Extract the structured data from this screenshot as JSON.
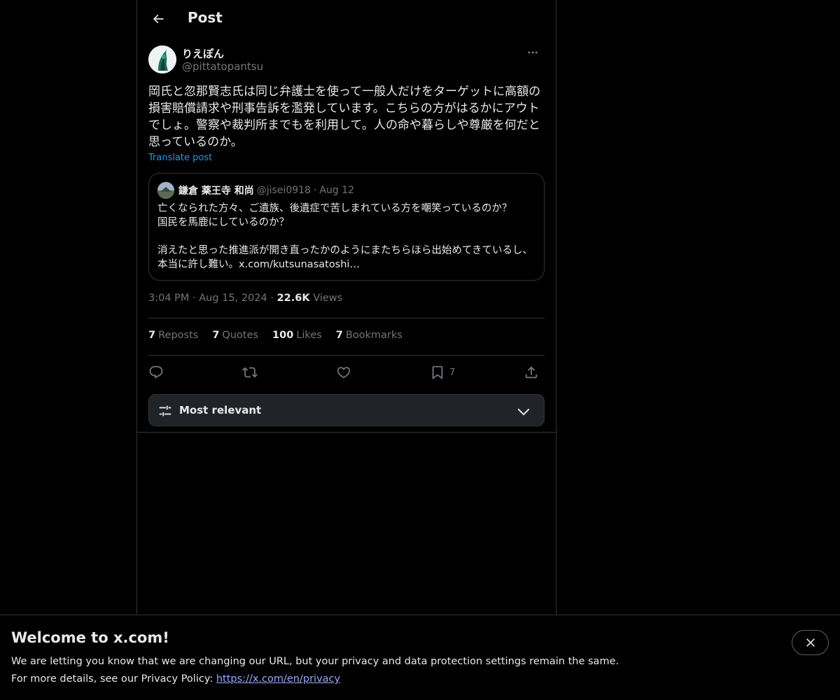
{
  "header": {
    "title": "Post"
  },
  "post": {
    "author": {
      "display_name": "りえぽん",
      "handle": "@pittatopantsu"
    },
    "text": "岡氏と忽那賢志氏は同じ弁護士を使って一般人だけをターゲットに高額の損害賠償請求や刑事告訴を濫発しています。こちらの方がはるかにアウトでしょ。警察や裁判所までもを利用して。人の命や暮らしや尊厳を何だと思っているのか。",
    "translate_label": "Translate post",
    "quote": {
      "display_name": "鎌倉 薬王寺 和尚",
      "handle": "@jisei0918",
      "separator": "·",
      "date": "Aug 12",
      "text": "亡くなられた方々、ご遺族、後遺症で苦しまれている方を嘲笑っているのか？\n国民を馬鹿にしているのか？\n\n消えたと思った推進派が開き直ったかのようにまたちらほら出始めてきているし、本当に許し難い。x.com/kutsunasatoshi…"
    },
    "time": "3:04 PM",
    "date": "Aug 15, 2024",
    "separator": "·",
    "views_count": "22.6K",
    "views_label": "Views",
    "stats": {
      "reposts_count": "7",
      "reposts_label": "Reposts",
      "quotes_count": "7",
      "quotes_label": "Quotes",
      "likes_count": "100",
      "likes_label": "Likes",
      "bookmarks_count": "7",
      "bookmarks_label": "Bookmarks"
    },
    "actions": {
      "bookmark_count": "7",
      "icons": [
        "reply-icon",
        "repost-icon",
        "like-icon",
        "bookmark-icon",
        "share-icon"
      ]
    }
  },
  "sort": {
    "label": "Most relevant"
  },
  "banner": {
    "title": "Welcome to x.com!",
    "line1": "We are letting you know that we are changing our URL, but your privacy and data protection settings remain the same.",
    "line2_prefix": "For more details, see our Privacy Policy: ",
    "link_text": "https://x.com/en/privacy"
  },
  "colors": {
    "background": "#000000",
    "text_primary": "#e7e9ea",
    "text_secondary": "#71767b",
    "accent": "#1d9bf0",
    "border": "#2f3336"
  }
}
